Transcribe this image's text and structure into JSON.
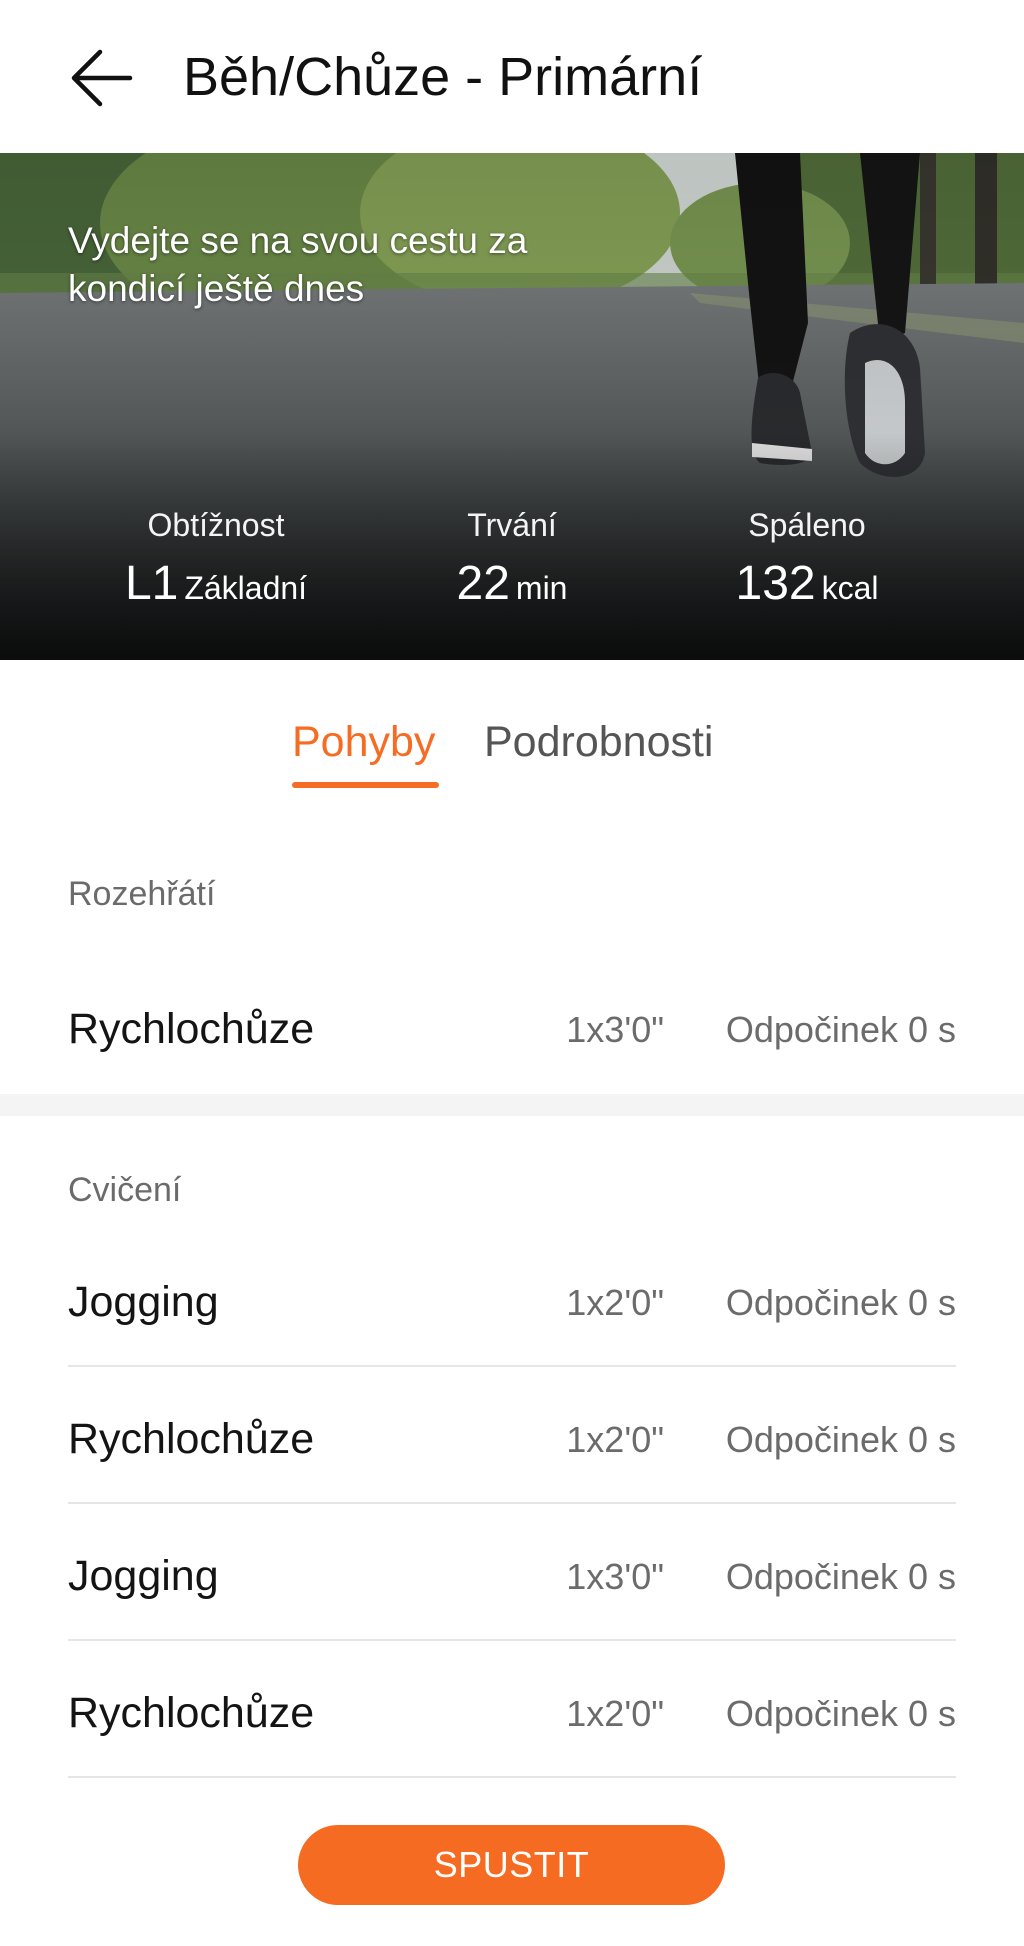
{
  "header": {
    "title": "Běh/Chůze - Primární",
    "back_icon": "arrow-left-icon"
  },
  "hero": {
    "tagline": "Vydejte se na svou cestu za kondicí ještě dnes",
    "stats": [
      {
        "label": "Obtížnost",
        "value": "L1",
        "unit": "Základní"
      },
      {
        "label": "Trvání",
        "value": "22",
        "unit": "min"
      },
      {
        "label": "Spáleno",
        "value": "132",
        "unit": "kcal"
      }
    ]
  },
  "tabs": {
    "active": "Pohyby",
    "inactive": "Podrobnosti"
  },
  "warmup": {
    "label": "Rozehřátí",
    "items": [
      {
        "name": "Rychlochůze",
        "reps": "1x3'0\"",
        "rest": "Odpočinek 0 s"
      }
    ]
  },
  "exercise": {
    "label": "Cvičení",
    "items": [
      {
        "name": "Jogging",
        "reps": "1x2'0\"",
        "rest": "Odpočinek 0 s"
      },
      {
        "name": "Rychlochůze",
        "reps": "1x2'0\"",
        "rest": "Odpočinek 0 s"
      },
      {
        "name": "Jogging",
        "reps": "1x3'0\"",
        "rest": "Odpočinek 0 s"
      },
      {
        "name": "Rychlochůze",
        "reps": "1x2'0\"",
        "rest": "Odpočinek 0 s"
      }
    ]
  },
  "start_button": "SPUSTIT",
  "colors": {
    "accent": "#f56c24",
    "button": "#f66b22",
    "muted_text": "#6b6b6b"
  }
}
